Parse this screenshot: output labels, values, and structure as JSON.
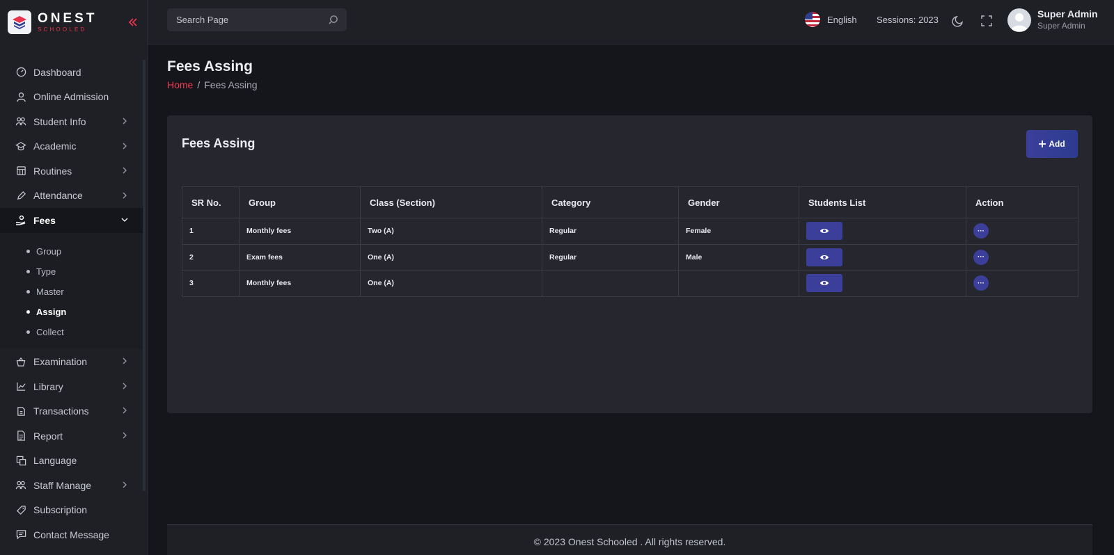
{
  "brand": {
    "name": "ONEST",
    "sub": "SCHOOLED"
  },
  "search": {
    "placeholder": "Search Page"
  },
  "header": {
    "language": "English",
    "session": "Sessions: 2023",
    "user_name": "Super Admin",
    "user_role": "Super Admin"
  },
  "sidebar": {
    "items": [
      {
        "label": "Dashboard"
      },
      {
        "label": "Online Admission"
      },
      {
        "label": "Student Info"
      },
      {
        "label": "Academic"
      },
      {
        "label": "Routines"
      },
      {
        "label": "Attendance"
      },
      {
        "label": "Fees"
      },
      {
        "label": "Examination"
      },
      {
        "label": "Library"
      },
      {
        "label": "Transactions"
      },
      {
        "label": "Report"
      },
      {
        "label": "Language"
      },
      {
        "label": "Staff Manage"
      },
      {
        "label": "Subscription"
      },
      {
        "label": "Contact Message"
      }
    ],
    "fees_sub": [
      {
        "label": "Group"
      },
      {
        "label": "Type"
      },
      {
        "label": "Master"
      },
      {
        "label": "Assign"
      },
      {
        "label": "Collect"
      }
    ]
  },
  "page": {
    "title": "Fees Assing",
    "breadcrumb_home": "Home",
    "breadcrumb_current": "Fees Assing"
  },
  "card": {
    "title": "Fees Assing",
    "add_label": "Add"
  },
  "table": {
    "headers": [
      "SR No.",
      "Group",
      "Class (Section)",
      "Category",
      "Gender",
      "Students List",
      "Action"
    ],
    "rows": [
      {
        "sr": "1",
        "group": "Monthly fees",
        "class": "Two (A)",
        "category": "Regular",
        "gender": "Female"
      },
      {
        "sr": "2",
        "group": "Exam fees",
        "class": "One (A)",
        "category": "Regular",
        "gender": "Male"
      },
      {
        "sr": "3",
        "group": "Monthly fees",
        "class": "One (A)",
        "category": "",
        "gender": ""
      }
    ],
    "action_label": "···"
  },
  "footer": {
    "text": "© 2023 Onest Schooled . All rights reserved."
  },
  "colors": {
    "accent": "#3b3f9a",
    "brand_red": "#e8334d",
    "background": "#15161b",
    "panel": "#26272e"
  }
}
